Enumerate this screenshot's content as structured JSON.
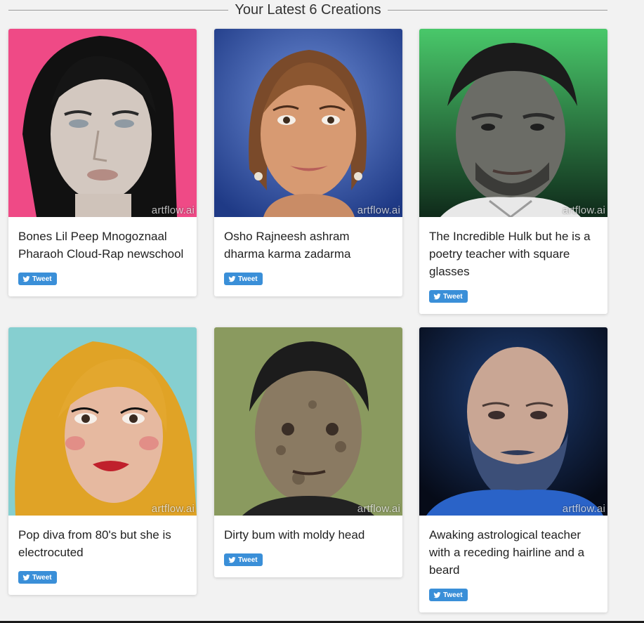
{
  "heading": "Your Latest 6 Creations",
  "watermark": "artflow.ai",
  "tweet_label": "Tweet",
  "cards": [
    {
      "caption": "Bones Lil Peep Mnogoznaal Pharaoh Cloud-Rap newschool"
    },
    {
      "caption": "Osho Rajneesh ashram dharma karma zadarma"
    },
    {
      "caption": "The Incredible Hulk but he is a poetry teacher with square glasses"
    },
    {
      "caption": "Pop diva from 80's but she is electrocuted"
    },
    {
      "caption": "Dirty bum with moldy head"
    },
    {
      "caption": "Awaking astrological teacher with a receding hairline and a beard"
    }
  ],
  "colors": {
    "tweet_button": "#3a8fd8",
    "page_background": "#f2f2f2"
  },
  "icons": {
    "tweet": "twitter-bird-icon"
  }
}
